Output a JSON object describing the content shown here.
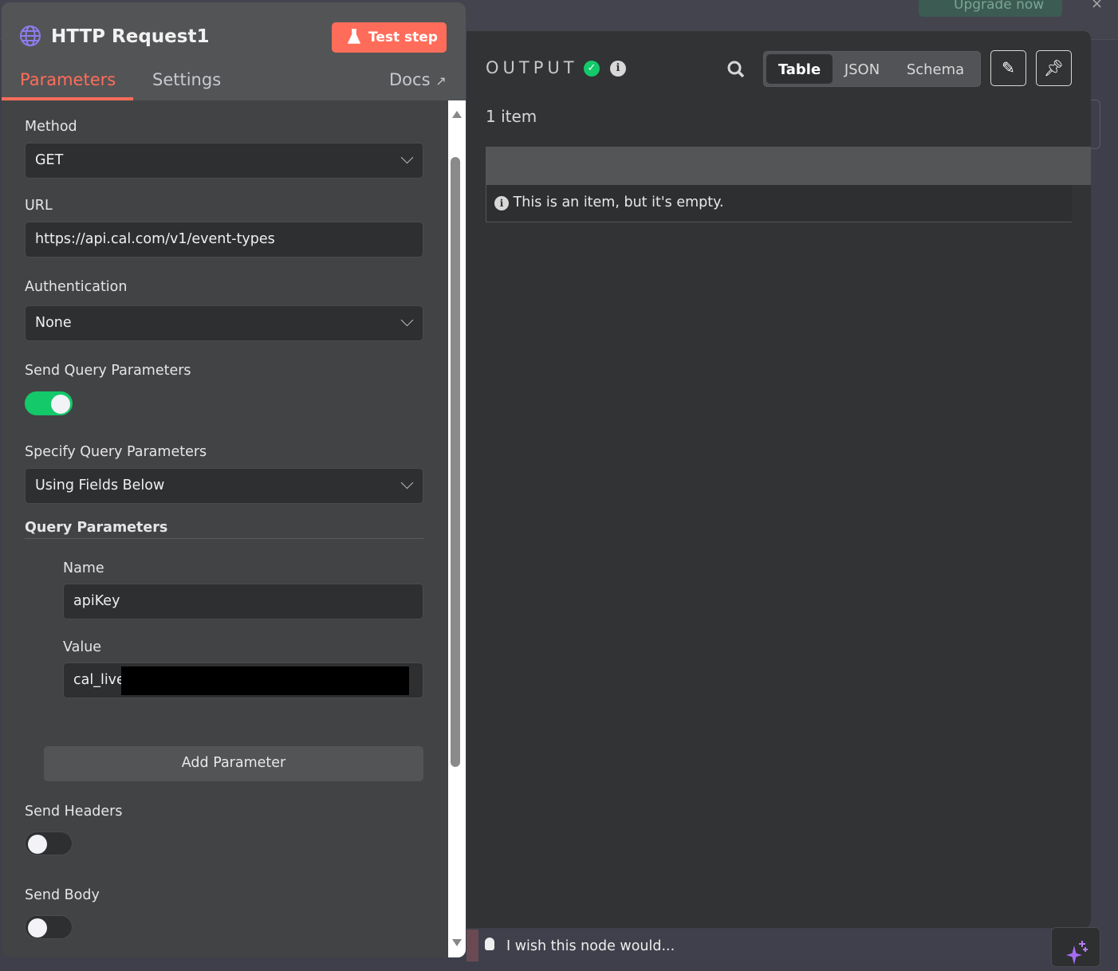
{
  "topbar": {
    "upgrade_label": "Upgrade now",
    "close_icon": "×"
  },
  "node": {
    "title": "HTTP Request1",
    "test_step_label": "Test step"
  },
  "tabs": {
    "parameters": "Parameters",
    "settings": "Settings",
    "docs": "Docs"
  },
  "fields": {
    "method": {
      "label": "Method",
      "value": "GET"
    },
    "url": {
      "label": "URL",
      "value": "https://api.cal.com/v1/event-types"
    },
    "authentication": {
      "label": "Authentication",
      "value": "None"
    },
    "send_query": {
      "label": "Send Query Parameters",
      "on": true
    },
    "specify_query": {
      "label": "Specify Query Parameters",
      "value": "Using Fields Below"
    },
    "query_parameters": {
      "label": "Query Parameters",
      "name_label": "Name",
      "name_value": "apiKey",
      "value_label": "Value",
      "value_value": "cal_live"
    },
    "add_parameter": "Add Parameter",
    "send_headers": {
      "label": "Send Headers",
      "on": false
    },
    "send_body": {
      "label": "Send Body",
      "on": false
    }
  },
  "output": {
    "label": "OUTPUT",
    "views": [
      "Table",
      "JSON",
      "Schema"
    ],
    "active_view": "Table",
    "item_count": "1 item",
    "empty_message": "This is an item, but it's empty."
  },
  "feedback": {
    "placeholder": "I wish this node would..."
  },
  "colors": {
    "accent": "#ff6d5a",
    "success": "#13c96a",
    "ai": "#a56cf5"
  }
}
